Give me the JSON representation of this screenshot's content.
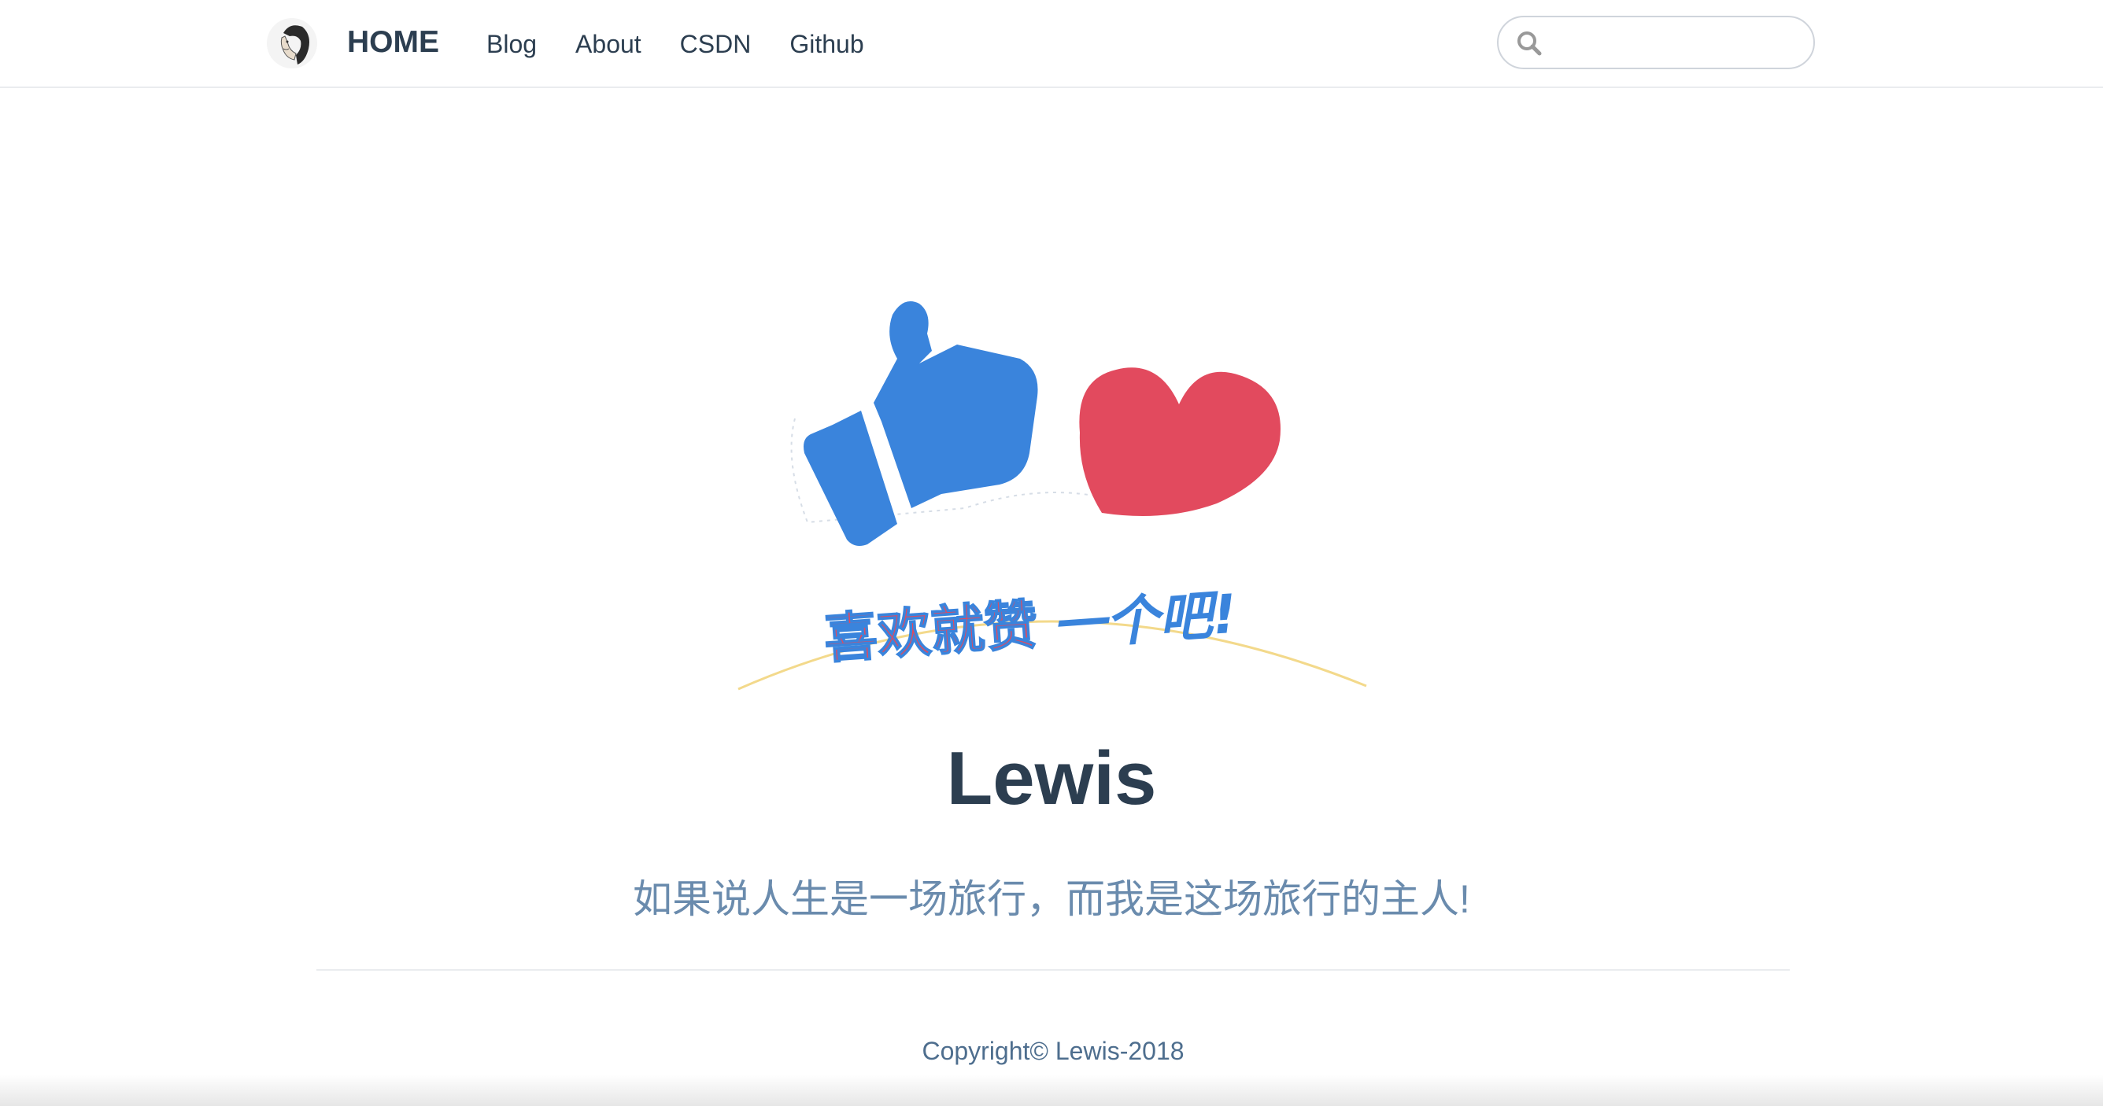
{
  "navbar": {
    "site_name": "HOME",
    "links": [
      "Blog",
      "About",
      "CSDN",
      "Github"
    ],
    "search": {
      "value": "",
      "placeholder": ""
    }
  },
  "hero": {
    "image_text_part1": "喜欢就赞",
    "image_text_part2": "一个吧!",
    "title": "Lewis",
    "description": "如果说人生是一场旅行，而我是这场旅行的主人!"
  },
  "footer": {
    "copyright": "Copyright© Lewis-2018"
  },
  "colors": {
    "thumb_blue": "#3a84dc",
    "heart_red": "#e24a5e",
    "text_dark": "#2c3e50",
    "text_desc": "#6a8bad"
  }
}
